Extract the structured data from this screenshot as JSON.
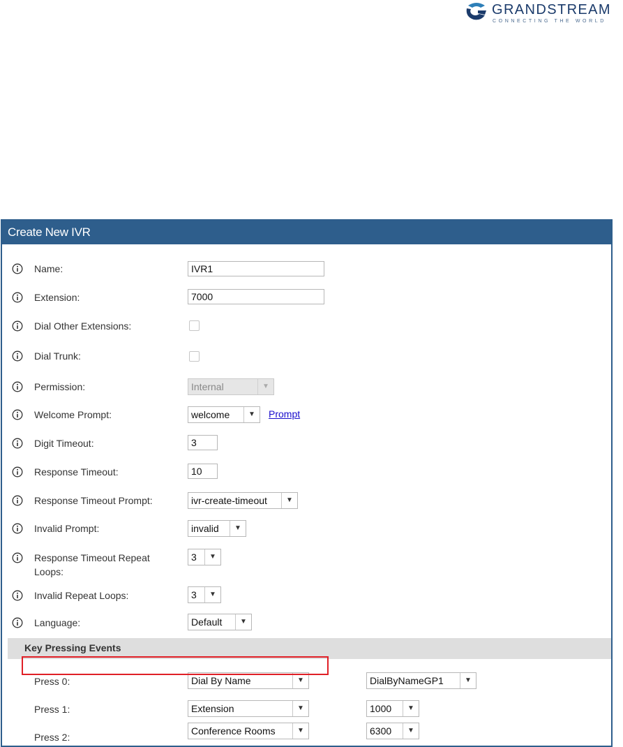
{
  "logo": {
    "brand": "GRANDSTREAM",
    "tagline": "CONNECTING THE WORLD"
  },
  "dialog": {
    "title": "Create New IVR"
  },
  "fields": {
    "name": {
      "label": "Name:",
      "value": "IVR1"
    },
    "extension": {
      "label": "Extension:",
      "value": "7000"
    },
    "dial_other_extensions": {
      "label": "Dial Other Extensions:",
      "checked": false
    },
    "dial_trunk": {
      "label": "Dial Trunk:",
      "checked": false
    },
    "permission": {
      "label": "Permission:",
      "value": "Internal"
    },
    "welcome_prompt": {
      "label": "Welcome Prompt:",
      "value": "welcome",
      "link": "Prompt"
    },
    "digit_timeout": {
      "label": "Digit Timeout:",
      "value": "3"
    },
    "response_timeout": {
      "label": "Response Timeout:",
      "value": "10"
    },
    "response_timeout_prompt": {
      "label": "Response Timeout Prompt:",
      "value": "ivr-create-timeout"
    },
    "invalid_prompt": {
      "label": "Invalid Prompt:",
      "value": "invalid"
    },
    "response_timeout_repeat_loops": {
      "label_line1": "Response Timeout Repeat",
      "label_line2": "Loops:",
      "value": "3"
    },
    "invalid_repeat_loops": {
      "label": "Invalid Repeat Loops:",
      "value": "3"
    },
    "language": {
      "label": "Language:",
      "value": "Default"
    }
  },
  "key_pressing": {
    "title": "Key Pressing Events",
    "rows": [
      {
        "label": "Press 0:",
        "event": "Dial By Name",
        "target": "DialByNameGP1"
      },
      {
        "label": "Press 1:",
        "event": "Extension",
        "target": "1000"
      },
      {
        "label": "Press 2:",
        "event": "Conference Rooms",
        "target": "6300"
      }
    ]
  },
  "icons": {
    "info": "info-circle-icon",
    "dropdown": "triangle-down-icon"
  },
  "colors": {
    "header": "#2e5e8c",
    "highlight": "#e01f26",
    "link": "#1a0dcc",
    "section": "#dedede"
  }
}
